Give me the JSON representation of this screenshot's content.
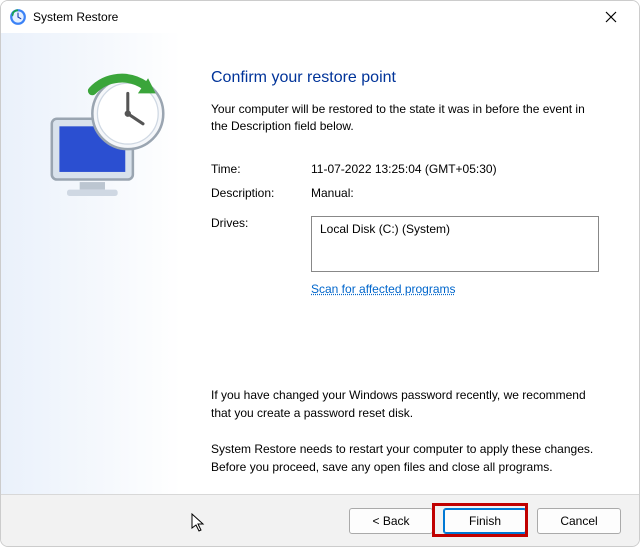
{
  "window": {
    "title": "System Restore"
  },
  "page": {
    "heading": "Confirm your restore point",
    "intro": "Your computer will be restored to the state it was in before the event in the Description field below."
  },
  "fields": {
    "time_label": "Time:",
    "time_value": "11-07-2022 13:25:04 (GMT+05:30)",
    "description_label": "Description:",
    "description_value": "Manual:",
    "drives_label": "Drives:",
    "drives_value": "Local Disk (C:) (System)"
  },
  "links": {
    "scan": "Scan for affected programs"
  },
  "notes": {
    "p1": "If you have changed your Windows password recently, we recommend that you create a password reset disk.",
    "p2": "System Restore needs to restart your computer to apply these changes. Before you proceed, save any open files and close all programs."
  },
  "buttons": {
    "back": "< Back",
    "finish": "Finish",
    "cancel": "Cancel"
  }
}
